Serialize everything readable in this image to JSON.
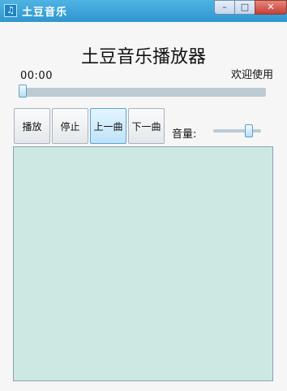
{
  "window": {
    "title": "土豆音乐",
    "app_icon": "music-note-icon",
    "controls": {
      "minimize": "–",
      "maximize": "□",
      "close": "✕"
    }
  },
  "header": {
    "title": "土豆音乐播放器",
    "status": "欢迎使用"
  },
  "playback": {
    "time": "00:00",
    "progress": 0
  },
  "buttons": {
    "play": "播放",
    "stop": "停止",
    "prev": "上一曲",
    "next": "下一曲"
  },
  "volume": {
    "label": "音量:",
    "level": 0.78
  },
  "playlist": {
    "items": []
  },
  "colors": {
    "titlebar": "#3aa3da",
    "accent_button": "#bfe3f8",
    "playlist_bg": "#cde8e3"
  }
}
